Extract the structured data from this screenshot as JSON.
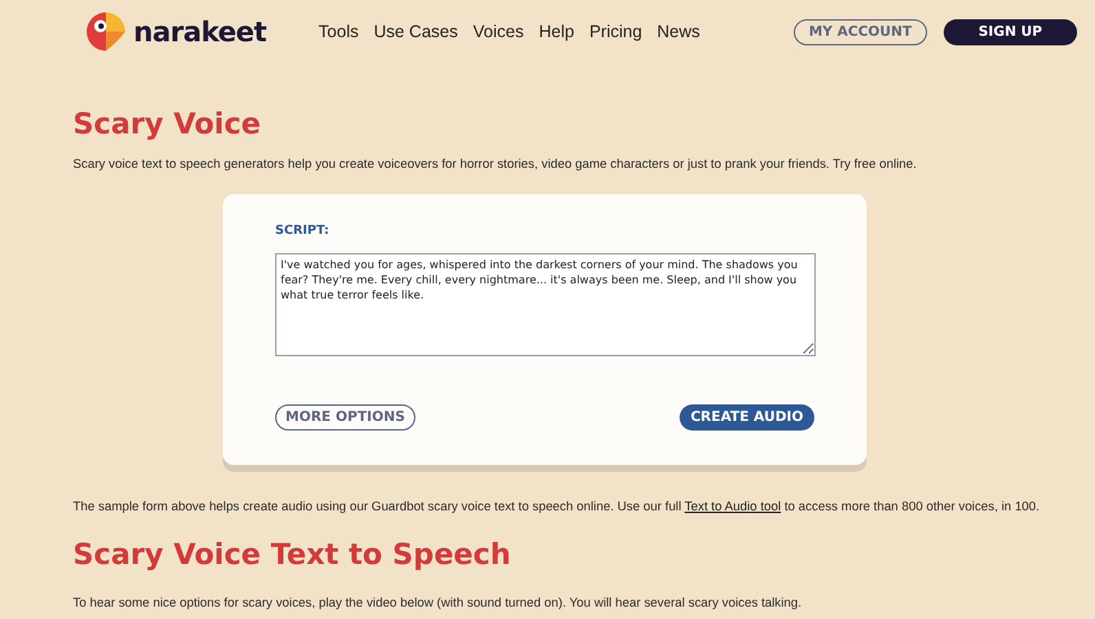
{
  "header": {
    "logo_text": "narakeet",
    "nav": [
      "Tools",
      "Use Cases",
      "Voices",
      "Help",
      "Pricing",
      "News"
    ],
    "account_button": "MY ACCOUNT",
    "signup_button": "SIGN UP"
  },
  "title": "Scary Voice",
  "intro": "Scary voice text to speech generators help you create voiceovers for horror stories, video game characters or just to prank your friends. Try free online.",
  "form": {
    "label": "SCRIPT:",
    "script": "I've watched you for ages, whispered into the darkest corners of your mind. The shadows you fear? They're me. Every chill, every nightmare... it's always been me. Sleep, and I'll show you what true terror feels like.",
    "options_button": "MORE OPTIONS",
    "create_button": "CREATE AUDIO"
  },
  "note": {
    "before": "The sample form above helps create audio using our Guardbot scary voice text to speech online. Use our full ",
    "link": "Text to Audio tool",
    "after": " to access more than 800 other voices, in 100."
  },
  "subtitle": "Scary Voice Text to Speech",
  "body": "To hear some nice options for scary voices, play the video below (with sound turned on). You will hear several scary voices talking."
}
